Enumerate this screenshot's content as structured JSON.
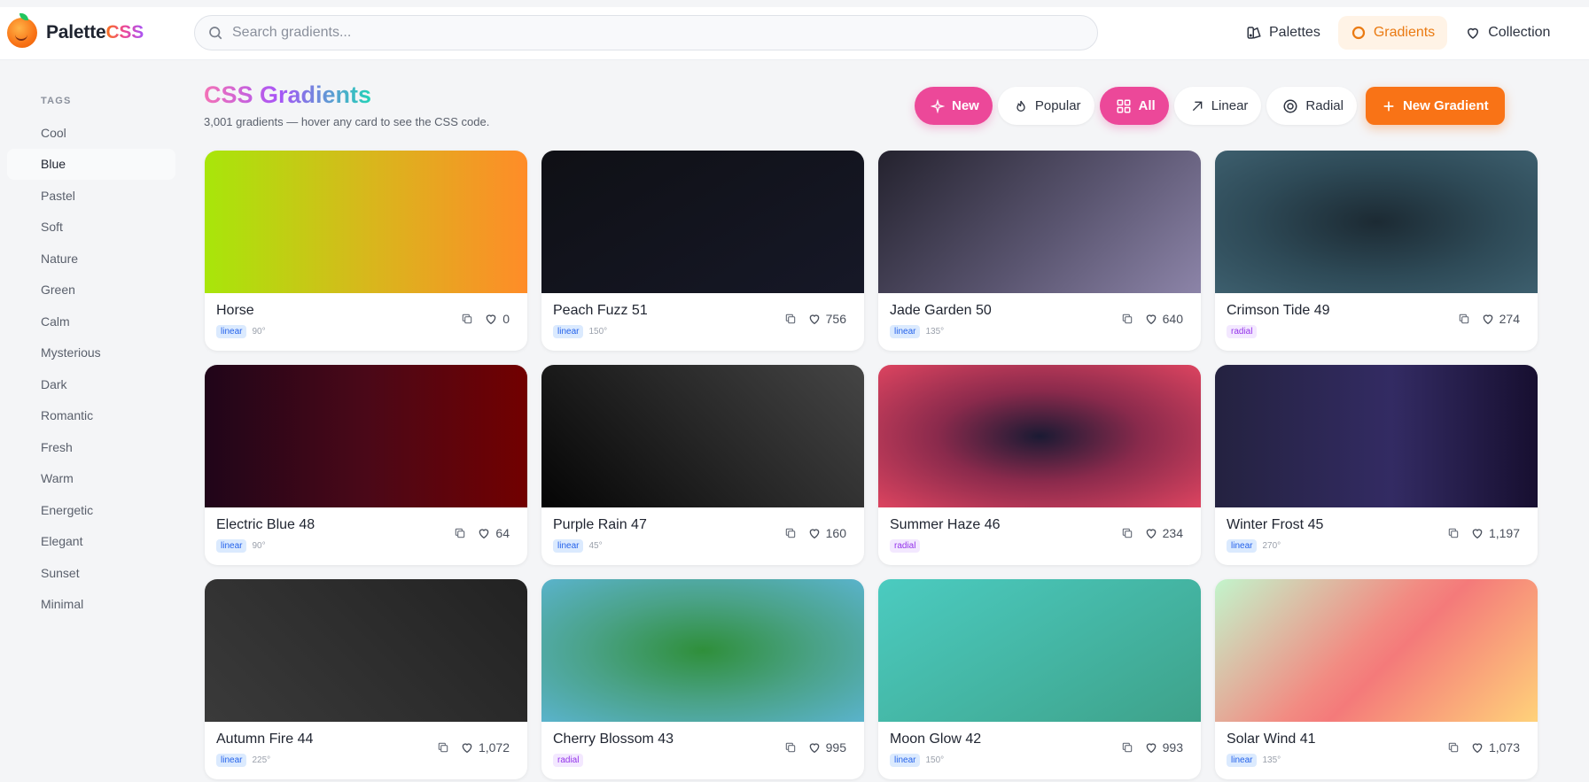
{
  "brand": {
    "name": "Palette",
    "accent": "CSS"
  },
  "search": {
    "placeholder": "Search gradients..."
  },
  "nav": [
    {
      "label": "Palettes",
      "icon": "palette-icon"
    },
    {
      "label": "Gradients",
      "icon": "circle-icon",
      "active": true
    },
    {
      "label": "Collection",
      "icon": "heart-icon"
    }
  ],
  "sidebar": {
    "title": "TAGS",
    "tags": [
      "Cool",
      "Blue",
      "Pastel",
      "Soft",
      "Nature",
      "Green",
      "Calm",
      "Mysterious",
      "Dark",
      "Romantic",
      "Fresh",
      "Warm",
      "Energetic",
      "Elegant",
      "Sunset",
      "Minimal"
    ],
    "active_tag": "Blue"
  },
  "main": {
    "title": "CSS Gradients",
    "subtitle": "3,001 gradients — hover any card to see the CSS code."
  },
  "filters": {
    "new": "New",
    "popular": "Popular",
    "all": "All",
    "linear": "Linear",
    "radial": "Radial",
    "new_gradient": "New Gradient"
  },
  "colors": {
    "accent_orange": "#f97316",
    "accent_pink": "#ec4899",
    "linear_badge": "#2563eb",
    "radial_badge": "#9333ea"
  },
  "gradients": [
    {
      "name": "Horse",
      "type": "linear",
      "angle": "90°",
      "likes": "0",
      "css": "linear-gradient(90deg, #a8e60a 0%, #d7b81c 50%, #ff8c28 100%)"
    },
    {
      "name": "Peach Fuzz 51",
      "type": "linear",
      "angle": "150°",
      "likes": "756",
      "css": "linear-gradient(150deg, #0f1015 0%, #161827 100%)"
    },
    {
      "name": "Jade Garden 50",
      "type": "linear",
      "angle": "135°",
      "likes": "640",
      "css": "linear-gradient(135deg, #24222e 0%, #5a5570 55%, #8c84a8 100%)"
    },
    {
      "name": "Crimson Tide 49",
      "type": "radial",
      "angle": "",
      "likes": "274",
      "css": "radial-gradient(ellipse at center, #1c2a33 0%, #2e4a57 55%, #3d5f6e 100%)"
    },
    {
      "name": "Electric Blue 48",
      "type": "linear",
      "angle": "90°",
      "likes": "64",
      "css": "linear-gradient(90deg, #200519 0%, #4a0818 50%, #720000 100%)"
    },
    {
      "name": "Purple Rain 47",
      "type": "linear",
      "angle": "45°",
      "likes": "160",
      "css": "linear-gradient(45deg, #050505 0%, #262626 50%, #454545 100%)"
    },
    {
      "name": "Summer Haze 46",
      "type": "radial",
      "angle": "",
      "likes": "234",
      "css": "radial-gradient(ellipse at center, #1a1a33 0%, #8a2a4c 45%, #dd4460 100%)"
    },
    {
      "name": "Winter Frost 45",
      "type": "linear",
      "angle": "270°",
      "likes": "1,197",
      "css": "linear-gradient(270deg, #170f30 0%, #332b63 45%, #242240 100%)"
    },
    {
      "name": "Autumn Fire 44",
      "type": "linear",
      "angle": "225°",
      "likes": "1,072",
      "css": "linear-gradient(225deg, #222222 0%, #3a3a3a 100%)"
    },
    {
      "name": "Cherry Blossom 43",
      "type": "radial",
      "angle": "",
      "likes": "995",
      "css": "radial-gradient(ellipse at center, #2f8f3a 0%, #4aa287 50%, #5ab3cc 100%)"
    },
    {
      "name": "Moon Glow 42",
      "type": "linear",
      "angle": "150°",
      "likes": "993",
      "css": "linear-gradient(150deg, #4bcbc0 0%, #3ea28a 100%)"
    },
    {
      "name": "Solar Wind 41",
      "type": "linear",
      "angle": "135°",
      "likes": "1,073",
      "css": "linear-gradient(135deg, #c2f5cc 0%, #f28b82 45%, #f47a7a 55%, #ffd27a 100%)"
    }
  ]
}
